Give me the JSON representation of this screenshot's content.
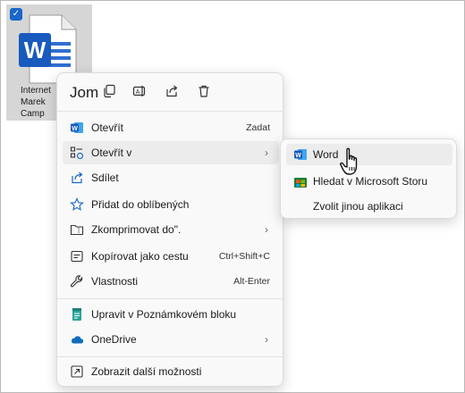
{
  "file": {
    "name_lines": [
      "Internet",
      "Marek",
      "Camp"
    ],
    "checked": true,
    "icon": "word-document-icon",
    "accent": "#185abd"
  },
  "menu": {
    "header_text": "Jom",
    "top_actions": [
      {
        "icon": "copy-icon"
      },
      {
        "icon": "rename-icon"
      },
      {
        "icon": "share-icon"
      },
      {
        "icon": "trash-icon"
      }
    ],
    "items": [
      {
        "label": "Otevřít",
        "shortcut": "Zadat",
        "icon": "word-icon"
      },
      {
        "label": "Otevřít v",
        "icon": "open-with-icon",
        "submenu": true
      },
      {
        "label": "Sdílet",
        "icon": "share-icon"
      },
      {
        "label": "Přidat do oblíbených",
        "icon": "star-icon"
      },
      {
        "label": "Zkomprimovat do\".",
        "icon": "zip-folder-icon",
        "submenu": true
      },
      {
        "label": "Kopírovat jako cestu",
        "shortcut": "Ctrl+Shift+C",
        "icon": "copy-path-icon"
      },
      {
        "label": "Vlastnosti",
        "shortcut": "Alt-Enter",
        "icon": "wrench-icon"
      },
      {
        "label": "Upravit v Poznámkovém bloku",
        "icon": "notepad-icon"
      },
      {
        "label": "OneDrive",
        "icon": "cloud-icon",
        "submenu": true
      },
      {
        "label": "Zobrazit další možnosti",
        "icon": "more-options-icon"
      }
    ]
  },
  "submenu": {
    "items": [
      {
        "label": "Word",
        "icon": "word-icon"
      },
      {
        "label": "Hledat v Microsoft Storu",
        "icon": "store-icon"
      },
      {
        "label": "Zvolit jinou aplikaci",
        "icon": ""
      }
    ]
  },
  "colors": {
    "word_blue": "#185abd",
    "accent": "#1a66c9",
    "onedrive": "#0f6cbd",
    "tile_bg": "#d6d6d6"
  }
}
